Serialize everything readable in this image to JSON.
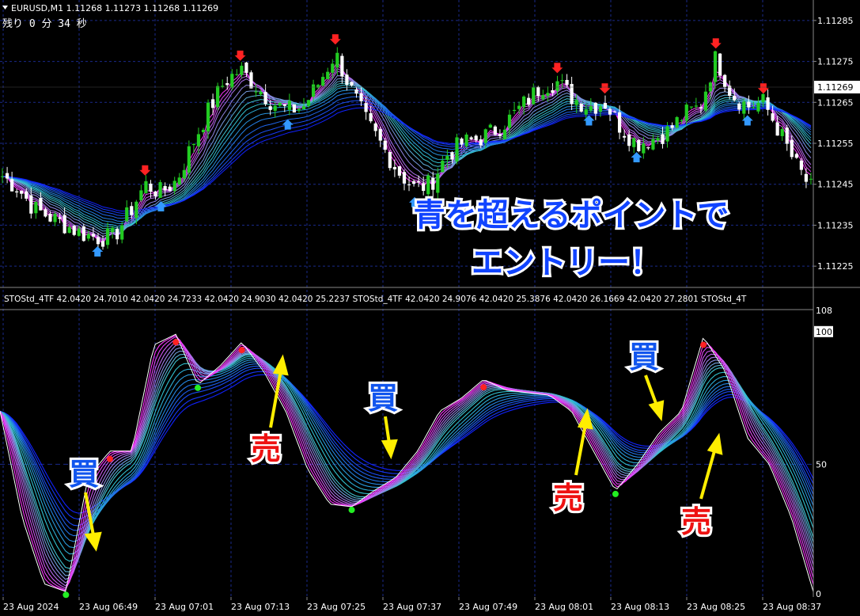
{
  "window": {
    "symbol_line": "EURUSD,M1  1.11268 1.11273 1.11268 1.11269",
    "countdown": "残り 0 分 34 秒"
  },
  "price_panel": {
    "price_ticks": [
      "1.11285",
      "1.11275",
      "1.11265",
      "1.11255",
      "1.11245",
      "1.11235",
      "1.11225"
    ],
    "current_price": "1.11269",
    "annotation_line1": "青を超えるポイントで",
    "annotation_line2": "エントリー！"
  },
  "indicator_panel": {
    "header": "STOStd_4TF 42.0420 24.7010 42.0420 24.7233 42.0420 24.9030 42.0420 25.2237  STOStd_4TF 42.0420 24.9076 42.0420 25.3876 42.0420 26.1669 42.0420 27.2801  STOStd_4T",
    "scale_ticks": [
      "108",
      "100",
      "50",
      "0"
    ],
    "labels": [
      {
        "text": "買",
        "color": "#1155ee"
      },
      {
        "text": "売",
        "color": "#ee1111"
      },
      {
        "text": "買",
        "color": "#1155ee"
      },
      {
        "text": "売",
        "color": "#ee1111"
      },
      {
        "text": "買",
        "color": "#1155ee"
      },
      {
        "text": "売",
        "color": "#ee1111"
      }
    ]
  },
  "time_axis": [
    "23 Aug 2024",
    "23 Aug 06:49",
    "23 Aug 07:01",
    "23 Aug 07:13",
    "23 Aug 07:25",
    "23 Aug 07:37",
    "23 Aug 07:49",
    "23 Aug 08:01",
    "23 Aug 08:13",
    "23 Aug 08:25",
    "23 Aug 08:37"
  ],
  "colors": {
    "bull_candle": "#22cc22",
    "bear_candle": "#ffffff",
    "grid": "#1a2a8a",
    "ribbon_fast": "#ff33ff",
    "ribbon_mid": "#33cccc",
    "ribbon_slow": "#1122ff",
    "sell_arrow": "#ff2222",
    "buy_arrow": "#3399ff",
    "label_arrow": "#ffff00"
  },
  "chart_data": [
    {
      "type": "candlestick",
      "title": "EURUSD,M1",
      "ylim": [
        1.1122,
        1.1129
      ],
      "close_trend": [
        1.11247,
        1.11244,
        1.11239,
        1.11237,
        1.11235,
        1.11233,
        1.11232,
        1.11232,
        1.11238,
        1.11245,
        1.11243,
        1.11246,
        1.11255,
        1.11263,
        1.1127,
        1.11273,
        1.11269,
        1.11265,
        1.11263,
        1.11264,
        1.1127,
        1.11277,
        1.11268,
        1.1126,
        1.11254,
        1.11248,
        1.11244,
        1.11245,
        1.11252,
        1.11255,
        1.11256,
        1.11258,
        1.11261,
        1.11265,
        1.11269,
        1.1127,
        1.11266,
        1.11264,
        1.11265,
        1.11259,
        1.11255,
        1.11256,
        1.11258,
        1.11262,
        1.11264,
        1.11276,
        1.11267,
        1.11264,
        1.11265,
        1.11258,
        1.1125,
        1.11244
      ]
    },
    {
      "type": "line",
      "title": "STOStd_4TF",
      "ylim": [
        0,
        108
      ],
      "x": [
        "23 Aug 2024",
        "23 Aug 06:49",
        "23 Aug 07:01",
        "23 Aug 07:13",
        "23 Aug 07:25",
        "23 Aug 07:37",
        "23 Aug 07:49",
        "23 Aug 08:01",
        "23 Aug 08:13",
        "23 Aug 08:25",
        "23 Aug 08:37"
      ],
      "main_line": [
        70,
        30,
        5,
        2,
        45,
        55,
        55,
        95,
        99,
        80,
        87,
        96,
        85,
        70,
        48,
        35,
        34,
        40,
        45,
        55,
        70,
        75,
        82,
        78,
        77,
        76,
        70,
        55,
        40,
        50,
        62,
        70,
        98,
        85,
        60,
        50,
        30,
        2
      ],
      "series": [
        {
          "name": "",
          "values": [
            42.042,
            24.701,
            42.042,
            24.7233,
            42.042,
            24.903,
            42.042,
            25.2237
          ]
        },
        {
          "name": "",
          "values": [
            42.042,
            24.9076,
            42.042,
            25.3876,
            42.042,
            26.1669,
            42.042,
            27.2801
          ]
        }
      ]
    }
  ]
}
